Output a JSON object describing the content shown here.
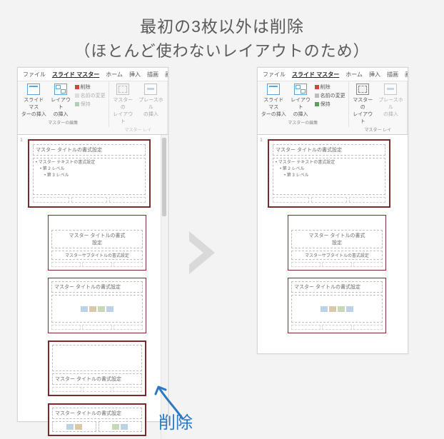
{
  "heading": {
    "line1": "最初の3枚以外は削除",
    "line2": "（ほとんど使わないレイアウトのため）"
  },
  "menu": {
    "file": "ファイル",
    "slideMaster": "スライド マスター",
    "home": "ホーム",
    "insert": "挿入",
    "draw": "描画",
    "view": "画面"
  },
  "ribbon": {
    "insertSlideMaster": "スライド マス\nターの挿入",
    "insertLayout": "レイアウト\nの挿入",
    "delete": "削除",
    "rename": "名前の変更",
    "preserve": "保持",
    "editMasterCaption": "マスターの編集",
    "masterLayout": "マスターの\nレイアウト",
    "insertPlaceholder": "プレースホル\nの挿入",
    "masterLayoutCaption": "マスター レイ"
  },
  "thumbs": {
    "pageNumber": "1",
    "masterTitle": "マスター タイトルの書式設定",
    "masterBodyL1": "• マスター テキストの書式設定",
    "masterBodyL2": "　• 第 2 レベル",
    "masterBodyL3": "　　• 第 3 レベル",
    "layoutTitleMultiline": "マスター タイトルの書式\n設定",
    "layoutSubtitle": "マスターサブタイトルの書式設定",
    "layoutTitleSingle": "マスター タイトルの書式設定"
  },
  "annotation": {
    "delete": "削除"
  }
}
